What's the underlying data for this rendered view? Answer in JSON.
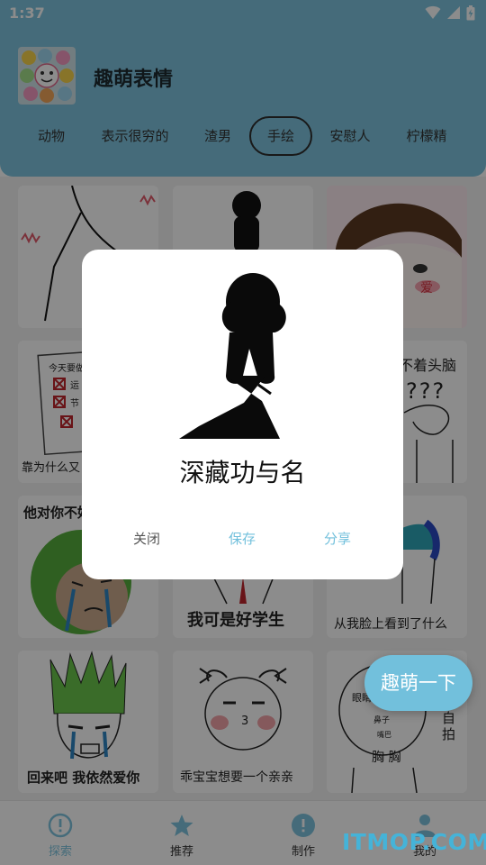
{
  "status_bar": {
    "time": "1:37"
  },
  "app": {
    "title": "趣萌表情"
  },
  "tabs": [
    {
      "label": "动物"
    },
    {
      "label": "表示很穷的"
    },
    {
      "label": "渣男"
    },
    {
      "label": "手绘",
      "active": true
    },
    {
      "label": "安慰人"
    },
    {
      "label": "柠檬精"
    }
  ],
  "cards": {
    "row2_left": {
      "caption": "靠为什么又",
      "list_title": "今天要做",
      "item1": "运",
      "item2": "节"
    },
    "row2_right": {
      "caption": "不着头脑",
      "marks": "???"
    },
    "row3_left": {
      "caption": "他对你不好"
    },
    "row3_mid": {
      "caption": "我可是好学生"
    },
    "row3_right": {
      "caption": "从我脸上看到了什么"
    },
    "row4_left": {
      "caption": "回来吧 我依然爱你"
    },
    "row4_mid": {
      "caption": "乖宝宝想要一个亲亲",
      "mouth": "3"
    },
    "row4_right": {
      "eye_label": "眼睛",
      "nose_label": "鼻子",
      "mouth_label": "嘴巴",
      "chest_label": "胸 胸",
      "side_text": "自拍"
    },
    "row1_right": {
      "blush_text": "爱"
    }
  },
  "dialog": {
    "title": "深藏功与名",
    "close_label": "关闭",
    "save_label": "保存",
    "share_label": "分享"
  },
  "fab": {
    "label": "趣萌一下"
  },
  "bottom_nav": [
    {
      "label": "探索",
      "icon": "alert-circle-icon",
      "active": true
    },
    {
      "label": "推荐",
      "icon": "star-icon"
    },
    {
      "label": "制作",
      "icon": "alert-circle-icon"
    },
    {
      "label": "我的",
      "icon": "person-icon"
    }
  ],
  "watermark": {
    "text": "ITMOP.COM"
  },
  "colors": {
    "accent": "#7ec4de",
    "nav_active": "#7ec4de",
    "nav_inactive": "#7ec4de"
  }
}
